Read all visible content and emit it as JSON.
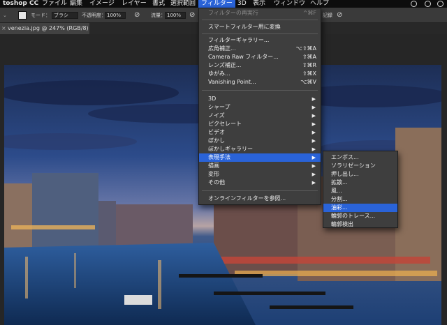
{
  "menubar": {
    "app": "toshop CC",
    "items": [
      "ファイル",
      "編集",
      "イメージ",
      "レイヤー",
      "書式",
      "選択範囲",
      "フィルター",
      "3D",
      "表示",
      "ウィンドウ",
      "ヘルプ"
    ],
    "active": "フィルター"
  },
  "options": {
    "mode_label": "モード：",
    "mode_value": "ブラシ",
    "opacity_label": "不透明度：",
    "opacity_value": "100%",
    "flow_label": "流量：",
    "flow_value": "100%",
    "history_label": "記録"
  },
  "document": {
    "tab_title": "venezia.jpg @ 247% (RGB/8) *"
  },
  "filter_menu": {
    "items": [
      {
        "label": "フィルターの再実行",
        "shortcut": "^⌘F",
        "disabled": true
      },
      {
        "label": "スマートフィルター用に変換"
      },
      {
        "label": "フィルターギャラリー..."
      },
      {
        "label": "広角補正...",
        "shortcut": "⌥⇧⌘A"
      },
      {
        "label": "Camera Raw フィルター...",
        "shortcut": "⇧⌘A"
      },
      {
        "label": "レンズ補正...",
        "shortcut": "⇧⌘R"
      },
      {
        "label": "ゆがみ...",
        "shortcut": "⇧⌘X"
      },
      {
        "label": "Vanishing Point...",
        "shortcut": "⌥⌘V"
      },
      {
        "label": "3D",
        "submenu": true
      },
      {
        "label": "シャープ",
        "submenu": true
      },
      {
        "label": "ノイズ",
        "submenu": true
      },
      {
        "label": "ピクセレート",
        "submenu": true
      },
      {
        "label": "ビデオ",
        "submenu": true
      },
      {
        "label": "ぼかし",
        "submenu": true
      },
      {
        "label": "ぼかしギャラリー",
        "submenu": true
      },
      {
        "label": "表現手法",
        "submenu": true,
        "highlighted": true
      },
      {
        "label": "描画",
        "submenu": true
      },
      {
        "label": "変形",
        "submenu": true
      },
      {
        "label": "その他",
        "submenu": true
      },
      {
        "label": "オンラインフィルターを参照..."
      }
    ]
  },
  "stylize_submenu": {
    "items": [
      {
        "label": "エンボス..."
      },
      {
        "label": "ソラリゼーション"
      },
      {
        "label": "押し出し..."
      },
      {
        "label": "拡散..."
      },
      {
        "label": "風..."
      },
      {
        "label": "分割..."
      },
      {
        "label": "油彩...",
        "highlighted": true
      },
      {
        "label": "輪郭のトレース..."
      },
      {
        "label": "輪郭検出"
      }
    ]
  },
  "colors": {
    "menu_bg": "#3e3e3e",
    "highlight": "#2a63d8",
    "options_bg": "#3a3a3a",
    "menubar_bg": "#0d0d0d"
  }
}
